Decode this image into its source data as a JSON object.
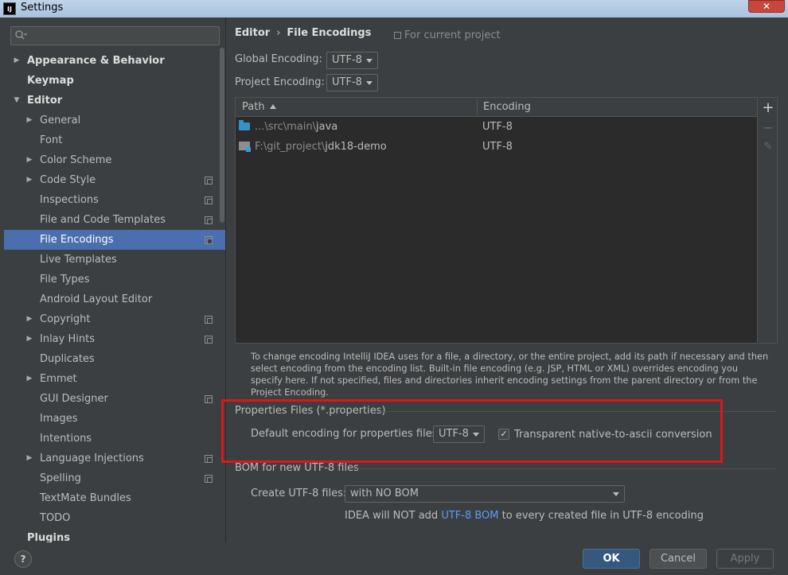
{
  "window": {
    "title": "Settings",
    "app_icon_text": "IJ",
    "close_glyph": "✕"
  },
  "sidebar": {
    "search_placeholder": "",
    "items": [
      {
        "label": "Appearance & Behavior",
        "level": 0,
        "arrow": "▶",
        "bold": true
      },
      {
        "label": "Keymap",
        "level": 0,
        "arrow": "",
        "bold": true
      },
      {
        "label": "Editor",
        "level": 0,
        "arrow": "▼",
        "bold": true
      },
      {
        "label": "General",
        "level": 1,
        "arrow": "▶"
      },
      {
        "label": "Font",
        "level": 1,
        "arrow": ""
      },
      {
        "label": "Color Scheme",
        "level": 1,
        "arrow": "▶"
      },
      {
        "label": "Code Style",
        "level": 1,
        "arrow": "▶",
        "project": true
      },
      {
        "label": "Inspections",
        "level": 1,
        "arrow": "",
        "project": true
      },
      {
        "label": "File and Code Templates",
        "level": 1,
        "arrow": "",
        "project": true
      },
      {
        "label": "File Encodings",
        "level": 1,
        "arrow": "",
        "project": true,
        "selected": true
      },
      {
        "label": "Live Templates",
        "level": 1,
        "arrow": ""
      },
      {
        "label": "File Types",
        "level": 1,
        "arrow": ""
      },
      {
        "label": "Android Layout Editor",
        "level": 1,
        "arrow": ""
      },
      {
        "label": "Copyright",
        "level": 1,
        "arrow": "▶",
        "project": true
      },
      {
        "label": "Inlay Hints",
        "level": 1,
        "arrow": "▶",
        "project": true
      },
      {
        "label": "Duplicates",
        "level": 1,
        "arrow": ""
      },
      {
        "label": "Emmet",
        "level": 1,
        "arrow": "▶"
      },
      {
        "label": "GUI Designer",
        "level": 1,
        "arrow": "",
        "project": true
      },
      {
        "label": "Images",
        "level": 1,
        "arrow": ""
      },
      {
        "label": "Intentions",
        "level": 1,
        "arrow": ""
      },
      {
        "label": "Language Injections",
        "level": 1,
        "arrow": "▶",
        "project": true
      },
      {
        "label": "Spelling",
        "level": 1,
        "arrow": "",
        "project": true
      },
      {
        "label": "TextMate Bundles",
        "level": 1,
        "arrow": ""
      },
      {
        "label": "TODO",
        "level": 1,
        "arrow": ""
      },
      {
        "label": "Plugins",
        "level": 0,
        "arrow": "",
        "bold": true
      }
    ]
  },
  "header": {
    "breadcrumb_parent": "Editor",
    "breadcrumb_sep": "›",
    "breadcrumb_current": "File Encodings",
    "scope_note": "For current project"
  },
  "encodings": {
    "global_label": "Global Encoding:",
    "global_value": "UTF-8",
    "project_label": "Project Encoding:",
    "project_value": "UTF-8"
  },
  "table": {
    "col_path": "Path",
    "col_encoding": "Encoding",
    "rows": [
      {
        "path_dim": "...\\src\\main\\",
        "path_bright": "java",
        "encoding": "UTF-8",
        "icon": "folder-icon"
      },
      {
        "path_dim": "F:\\git_project\\",
        "path_bright": "jdk18-demo",
        "encoding": "UTF-8",
        "icon": "module-icon"
      }
    ],
    "tools": {
      "add": "+",
      "remove": "−",
      "edit": "✎"
    }
  },
  "help_text": "To change encoding IntelliJ IDEA uses for a file, a directory, or the entire project, add its path if necessary and then select encoding from the encoding list. Built-in file encoding (e.g. JSP, HTML or XML) overrides encoding you specify here. If not specified, files and directories inherit encoding settings from the parent directory or from the Project Encoding.",
  "properties": {
    "group_title": "Properties Files (*.properties)",
    "default_label": "Default encoding for properties files:",
    "default_value": "UTF-8",
    "native_ascii_label": "Transparent native-to-ascii conversion",
    "native_ascii_checked": "✓"
  },
  "bom": {
    "group_title": "BOM for new UTF-8 files",
    "create_label": "Create UTF-8 files:",
    "create_value": "with NO BOM",
    "note_prefix": "IDEA will NOT add ",
    "note_link": "UTF-8 BOM",
    "note_suffix": " to every created file in UTF-8 encoding"
  },
  "footer": {
    "help": "?",
    "ok": "OK",
    "cancel": "Cancel",
    "apply": "Apply"
  },
  "colors": {
    "accent": "#4b6eaf",
    "link": "#589df6",
    "annotation": "#e01616"
  }
}
